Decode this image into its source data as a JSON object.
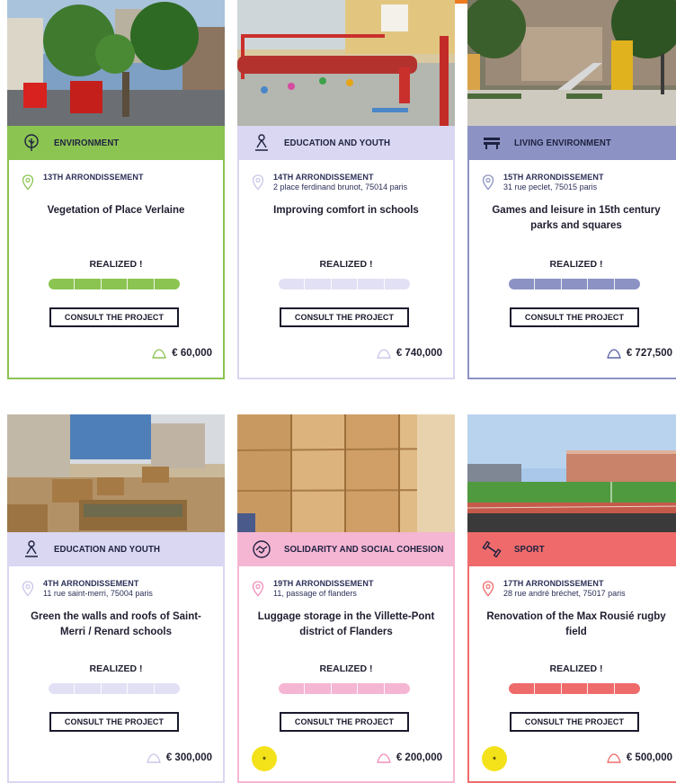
{
  "currency_prefix": "€",
  "button_label": "CONSULT THE PROJECT",
  "colors": {
    "top_accent": "#ef7a1f",
    "environment": "#8cc452",
    "education": "#d9d7f1",
    "living": "#8c93c4",
    "solidarity": "#f5b6d3",
    "sport": "#ef6b6b"
  },
  "cards": [
    {
      "category": "ENVIRONMENT",
      "category_icon": "tree-icon",
      "arrondissement": "13TH ARRONDISSEMENT",
      "address": "",
      "title": "Vegetation of Place Verlaine",
      "status": "REALIZED !",
      "budget": "60,000",
      "progress_fraction": 1,
      "badge": false
    },
    {
      "category": "EDUCATION AND YOUTH",
      "category_icon": "person-icon",
      "arrondissement": "14TH ARRONDISSEMENT",
      "address": "2 place ferdinand brunot, 75014 paris",
      "title": "Improving comfort in schools",
      "status": "REALIZED !",
      "budget": "740,000",
      "progress_fraction": 1,
      "badge": false
    },
    {
      "category": "LIVING ENVIRONMENT",
      "category_icon": "bench-icon",
      "arrondissement": "15TH ARRONDISSEMENT",
      "address": "31 rue peclet, 75015 paris",
      "title": "Games and leisure in 15th century parks and squares",
      "status": "REALIZED !",
      "budget": "727,500",
      "progress_fraction": 1,
      "badge": false
    },
    {
      "category": "EDUCATION AND YOUTH",
      "category_icon": "person-icon",
      "arrondissement": "4TH ARRONDISSEMENT",
      "address": "11 rue saint-merri, 75004 paris",
      "title": "Green the walls and roofs of Saint-Merri / Renard schools",
      "status": "REALIZED !",
      "budget": "300,000",
      "progress_fraction": 1,
      "badge": false
    },
    {
      "category": "SOLIDARITY AND SOCIAL COHESION",
      "category_icon": "handshake-icon",
      "arrondissement": "19TH ARRONDISSEMENT",
      "address": "11, passage of flanders",
      "title": "Luggage storage in the Villette-Pont district of Flanders",
      "status": "REALIZED !",
      "budget": "200,000",
      "progress_fraction": 1,
      "badge": true
    },
    {
      "category": "SPORT",
      "category_icon": "dumbbell-icon",
      "arrondissement": "17TH ARRONDISSEMENT",
      "address": "28 rue andré bréchet, 75017 paris",
      "title": "Renovation of the Max Rousié rugby field",
      "status": "REALIZED !",
      "budget": "500,000",
      "progress_fraction": 1,
      "badge": true
    }
  ]
}
